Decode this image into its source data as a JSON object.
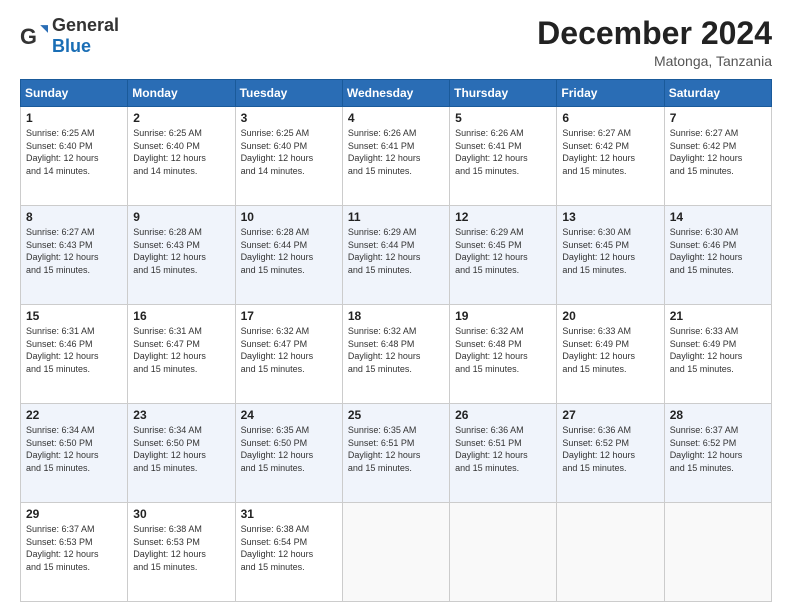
{
  "logo": {
    "text_general": "General",
    "text_blue": "Blue"
  },
  "header": {
    "month_title": "December 2024",
    "location": "Matonga, Tanzania"
  },
  "days_of_week": [
    "Sunday",
    "Monday",
    "Tuesday",
    "Wednesday",
    "Thursday",
    "Friday",
    "Saturday"
  ],
  "weeks": [
    [
      {
        "day": "1",
        "sunrise": "6:25 AM",
        "sunset": "6:40 PM",
        "daylight": "12 hours and 14 minutes."
      },
      {
        "day": "2",
        "sunrise": "6:25 AM",
        "sunset": "6:40 PM",
        "daylight": "12 hours and 14 minutes."
      },
      {
        "day": "3",
        "sunrise": "6:25 AM",
        "sunset": "6:40 PM",
        "daylight": "12 hours and 14 minutes."
      },
      {
        "day": "4",
        "sunrise": "6:26 AM",
        "sunset": "6:41 PM",
        "daylight": "12 hours and 15 minutes."
      },
      {
        "day": "5",
        "sunrise": "6:26 AM",
        "sunset": "6:41 PM",
        "daylight": "12 hours and 15 minutes."
      },
      {
        "day": "6",
        "sunrise": "6:27 AM",
        "sunset": "6:42 PM",
        "daylight": "12 hours and 15 minutes."
      },
      {
        "day": "7",
        "sunrise": "6:27 AM",
        "sunset": "6:42 PM",
        "daylight": "12 hours and 15 minutes."
      }
    ],
    [
      {
        "day": "8",
        "sunrise": "6:27 AM",
        "sunset": "6:43 PM",
        "daylight": "12 hours and 15 minutes."
      },
      {
        "day": "9",
        "sunrise": "6:28 AM",
        "sunset": "6:43 PM",
        "daylight": "12 hours and 15 minutes."
      },
      {
        "day": "10",
        "sunrise": "6:28 AM",
        "sunset": "6:44 PM",
        "daylight": "12 hours and 15 minutes."
      },
      {
        "day": "11",
        "sunrise": "6:29 AM",
        "sunset": "6:44 PM",
        "daylight": "12 hours and 15 minutes."
      },
      {
        "day": "12",
        "sunrise": "6:29 AM",
        "sunset": "6:45 PM",
        "daylight": "12 hours and 15 minutes."
      },
      {
        "day": "13",
        "sunrise": "6:30 AM",
        "sunset": "6:45 PM",
        "daylight": "12 hours and 15 minutes."
      },
      {
        "day": "14",
        "sunrise": "6:30 AM",
        "sunset": "6:46 PM",
        "daylight": "12 hours and 15 minutes."
      }
    ],
    [
      {
        "day": "15",
        "sunrise": "6:31 AM",
        "sunset": "6:46 PM",
        "daylight": "12 hours and 15 minutes."
      },
      {
        "day": "16",
        "sunrise": "6:31 AM",
        "sunset": "6:47 PM",
        "daylight": "12 hours and 15 minutes."
      },
      {
        "day": "17",
        "sunrise": "6:32 AM",
        "sunset": "6:47 PM",
        "daylight": "12 hours and 15 minutes."
      },
      {
        "day": "18",
        "sunrise": "6:32 AM",
        "sunset": "6:48 PM",
        "daylight": "12 hours and 15 minutes."
      },
      {
        "day": "19",
        "sunrise": "6:32 AM",
        "sunset": "6:48 PM",
        "daylight": "12 hours and 15 minutes."
      },
      {
        "day": "20",
        "sunrise": "6:33 AM",
        "sunset": "6:49 PM",
        "daylight": "12 hours and 15 minutes."
      },
      {
        "day": "21",
        "sunrise": "6:33 AM",
        "sunset": "6:49 PM",
        "daylight": "12 hours and 15 minutes."
      }
    ],
    [
      {
        "day": "22",
        "sunrise": "6:34 AM",
        "sunset": "6:50 PM",
        "daylight": "12 hours and 15 minutes."
      },
      {
        "day": "23",
        "sunrise": "6:34 AM",
        "sunset": "6:50 PM",
        "daylight": "12 hours and 15 minutes."
      },
      {
        "day": "24",
        "sunrise": "6:35 AM",
        "sunset": "6:50 PM",
        "daylight": "12 hours and 15 minutes."
      },
      {
        "day": "25",
        "sunrise": "6:35 AM",
        "sunset": "6:51 PM",
        "daylight": "12 hours and 15 minutes."
      },
      {
        "day": "26",
        "sunrise": "6:36 AM",
        "sunset": "6:51 PM",
        "daylight": "12 hours and 15 minutes."
      },
      {
        "day": "27",
        "sunrise": "6:36 AM",
        "sunset": "6:52 PM",
        "daylight": "12 hours and 15 minutes."
      },
      {
        "day": "28",
        "sunrise": "6:37 AM",
        "sunset": "6:52 PM",
        "daylight": "12 hours and 15 minutes."
      }
    ],
    [
      {
        "day": "29",
        "sunrise": "6:37 AM",
        "sunset": "6:53 PM",
        "daylight": "12 hours and 15 minutes."
      },
      {
        "day": "30",
        "sunrise": "6:38 AM",
        "sunset": "6:53 PM",
        "daylight": "12 hours and 15 minutes."
      },
      {
        "day": "31",
        "sunrise": "6:38 AM",
        "sunset": "6:54 PM",
        "daylight": "12 hours and 15 minutes."
      },
      null,
      null,
      null,
      null
    ]
  ],
  "labels": {
    "sunrise": "Sunrise:",
    "sunset": "Sunset:",
    "daylight": "Daylight:"
  }
}
